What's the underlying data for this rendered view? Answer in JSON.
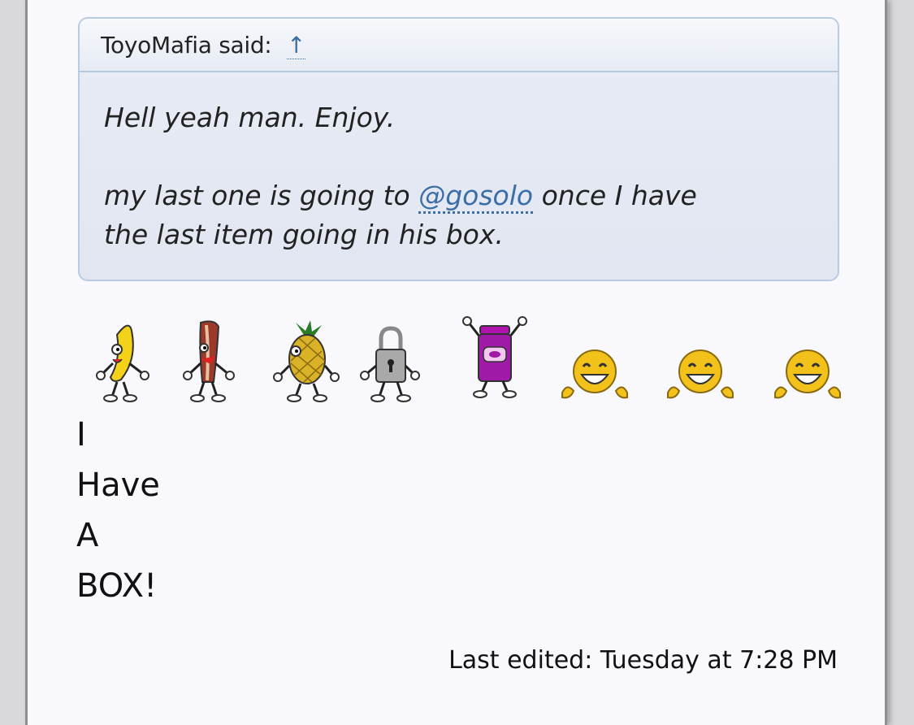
{
  "quote": {
    "author": "ToyoMafia",
    "said_suffix": "said:",
    "jump_link": "↑",
    "line1": "Hell yeah man. Enjoy.",
    "line2_before": "my last one is going to ",
    "mention": "@gosolo",
    "line2_after": " once I have",
    "line3": "the last item going in his box."
  },
  "smilies": [
    {
      "icon": "dancing-banana-icon"
    },
    {
      "icon": "dancing-bacon-icon"
    },
    {
      "icon": "dancing-pineapple-icon"
    },
    {
      "icon": "dancing-padlock-icon"
    },
    {
      "icon": "dancing-jelly-jar-icon"
    },
    {
      "icon": "laughing-smiley-icon"
    },
    {
      "icon": "laughing-smiley-icon"
    },
    {
      "icon": "laughing-smiley-icon"
    }
  ],
  "post_lines": [
    "I",
    "Have",
    "A",
    "BOX!"
  ],
  "last_edited": "Last edited: Tuesday at 7:28 PM",
  "colors": {
    "link": "#3b6ea6",
    "quote_border": "#b9cbe0",
    "page_bg": "#f9f9fd"
  }
}
